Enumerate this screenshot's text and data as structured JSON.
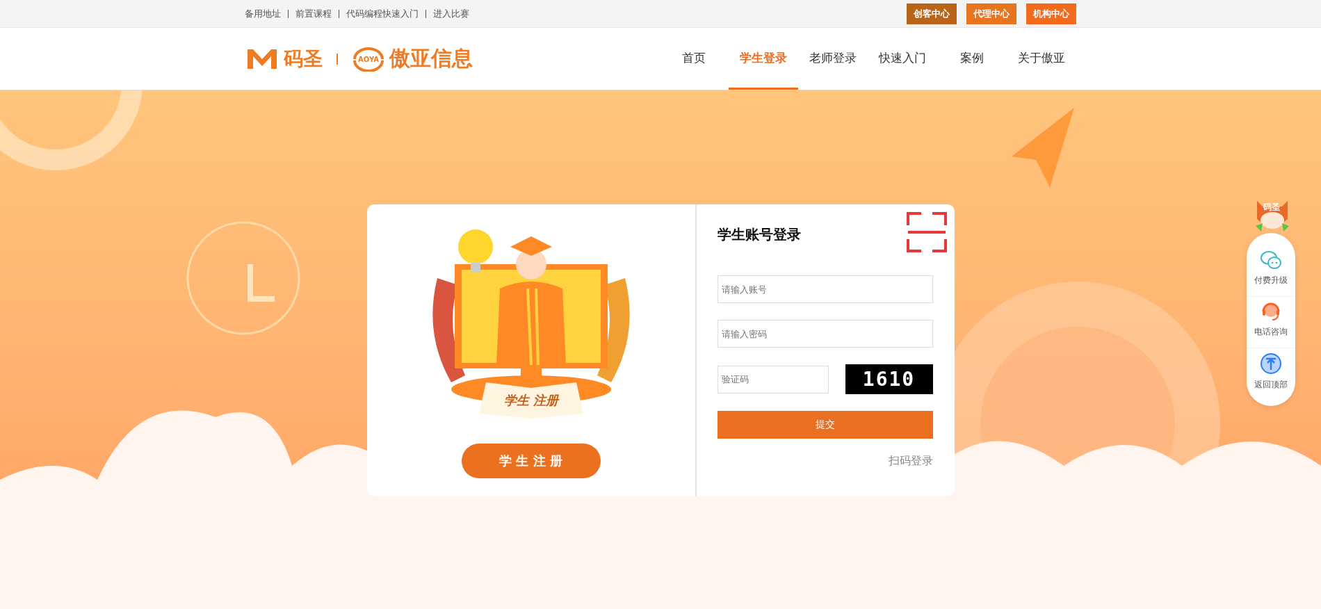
{
  "top_links": [
    "备用地址",
    "前置课程",
    "代码编程快速入门",
    "进入比赛"
  ],
  "top_buttons": [
    {
      "label": "创客中心",
      "color": "#b8651a"
    },
    {
      "label": "代理中心",
      "color": "#e8741e"
    },
    {
      "label": "机构中心",
      "color": "#f26b1d"
    }
  ],
  "logo": {
    "brand": "码圣",
    "company": "傲亚信息",
    "emblem_text": "AOYA"
  },
  "nav": [
    {
      "label": "首页",
      "selected": false
    },
    {
      "label": "学生登录",
      "selected": true
    },
    {
      "label": "老师登录",
      "selected": false
    },
    {
      "label": "快速入门",
      "selected": false
    },
    {
      "label": "案例",
      "selected": false
    },
    {
      "label": "关于傲亚",
      "selected": false
    }
  ],
  "register_panel": {
    "book_text": "学生 注册",
    "button": "学 生 注 册"
  },
  "login_panel": {
    "title": "学生账号登录",
    "account": {
      "placeholder": "请输入账号"
    },
    "password": {
      "placeholder": "请输入密码"
    },
    "captcha": {
      "placeholder": "验证码",
      "image_text": "1610"
    },
    "submit": "提交",
    "qr_login": "扫码登录"
  },
  "side_bar": {
    "mascot_label": "码圣",
    "items": [
      {
        "kind": "chat",
        "label": "付费升级"
      },
      {
        "kind": "phone",
        "label": "电话咨询"
      },
      {
        "kind": "top",
        "label": "返回顶部"
      }
    ]
  }
}
